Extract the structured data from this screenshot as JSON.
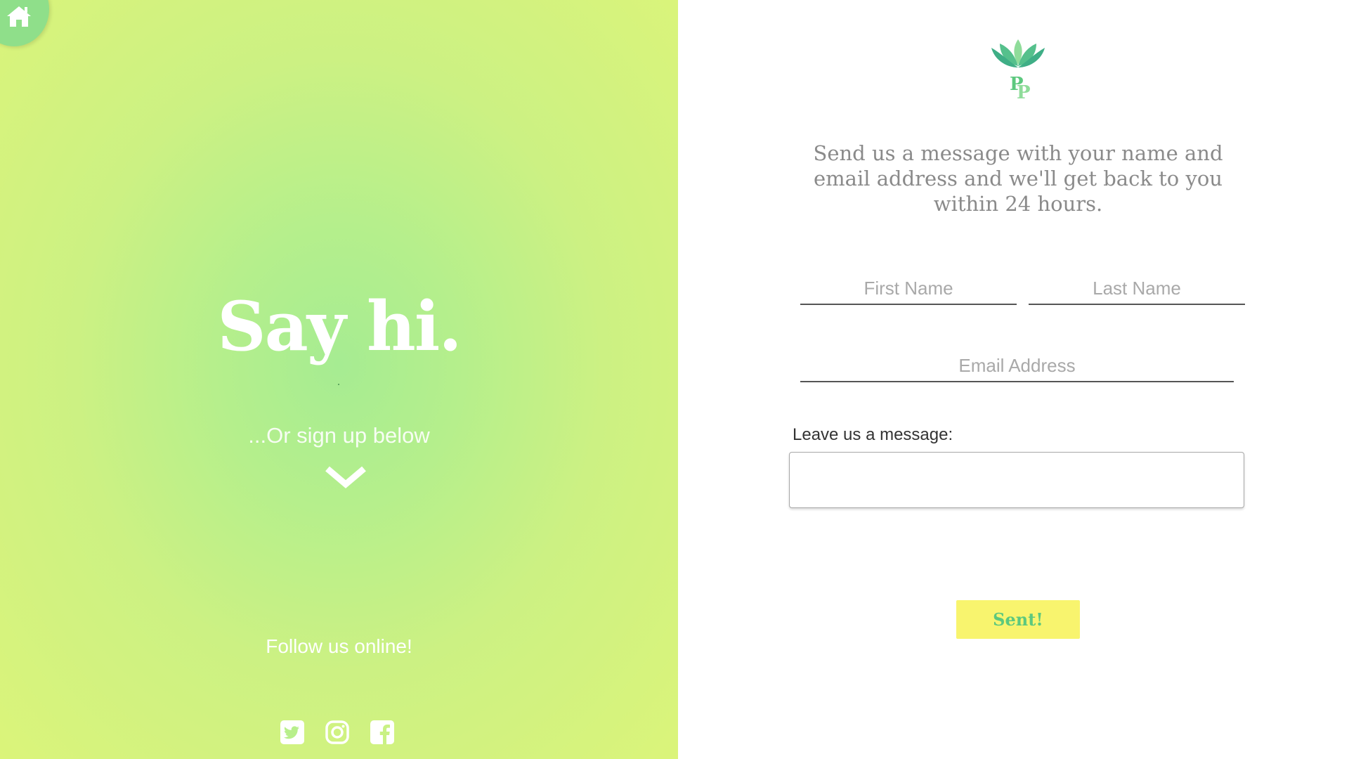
{
  "left_panel": {
    "home_icon": "home-icon",
    "heading": "Say hi.",
    "signup_text": "...Or sign up below",
    "chevron_icon": "chevron-down-icon",
    "follow_text": "Follow us online!",
    "socials": [
      {
        "icon": "twitter-icon"
      },
      {
        "icon": "instagram-icon"
      },
      {
        "icon": "facebook-icon"
      }
    ]
  },
  "right_panel": {
    "logo": "PP",
    "intro": "Send us a message with your name and email address and we'll get back to you within 24 hours.",
    "form": {
      "first_name_placeholder": "First Name",
      "last_name_placeholder": "Last Name",
      "email_placeholder": "Email Address",
      "message_label": "Leave us a message:",
      "message_value": "",
      "submit_label": "Sent!"
    }
  },
  "colors": {
    "gradient_center": "#a6ec92",
    "gradient_edge": "#dbf47a",
    "button_bg": "#f8f46e",
    "button_text": "#5cc87e",
    "logo_green": "#5cc87e"
  }
}
